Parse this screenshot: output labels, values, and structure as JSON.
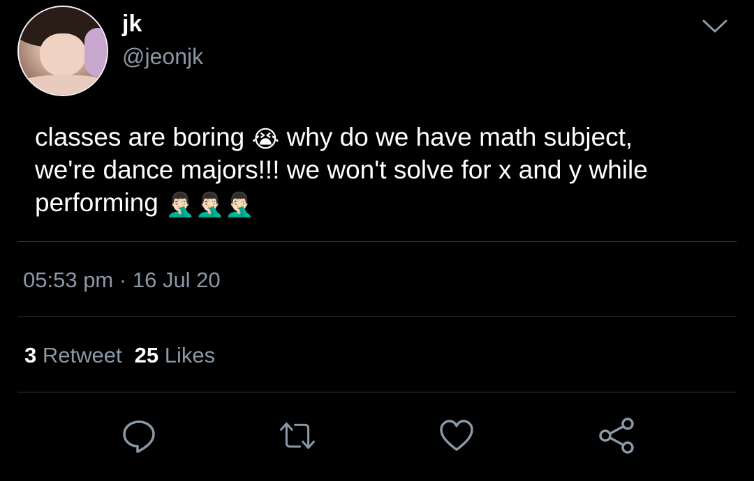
{
  "user": {
    "display_name": "jk",
    "handle": "@jeonjk"
  },
  "tweet": {
    "line1_a": "classes are boring",
    "emoji_crying": "😭",
    "line1_b": "why do we have math subject,",
    "line2": "we're dance majors!!! we won't solve for x and y while",
    "line3": "performing",
    "emoji_facepalm": "🤦🏻‍♂️"
  },
  "meta": {
    "time": "05:53 pm",
    "separator": "·",
    "date": "16 Jul 20"
  },
  "stats": {
    "retweet_count": "3",
    "retweet_label": "Retweet",
    "likes_count": "25",
    "likes_label": "Likes"
  },
  "icons": {
    "menu": "chevron-down-icon",
    "reply": "reply-icon",
    "retweet": "retweet-icon",
    "like": "heart-icon",
    "share": "share-icon"
  },
  "colors": {
    "background": "#000000",
    "text": "#ffffff",
    "secondary": "#8b98a5",
    "divider": "#2f3336"
  }
}
